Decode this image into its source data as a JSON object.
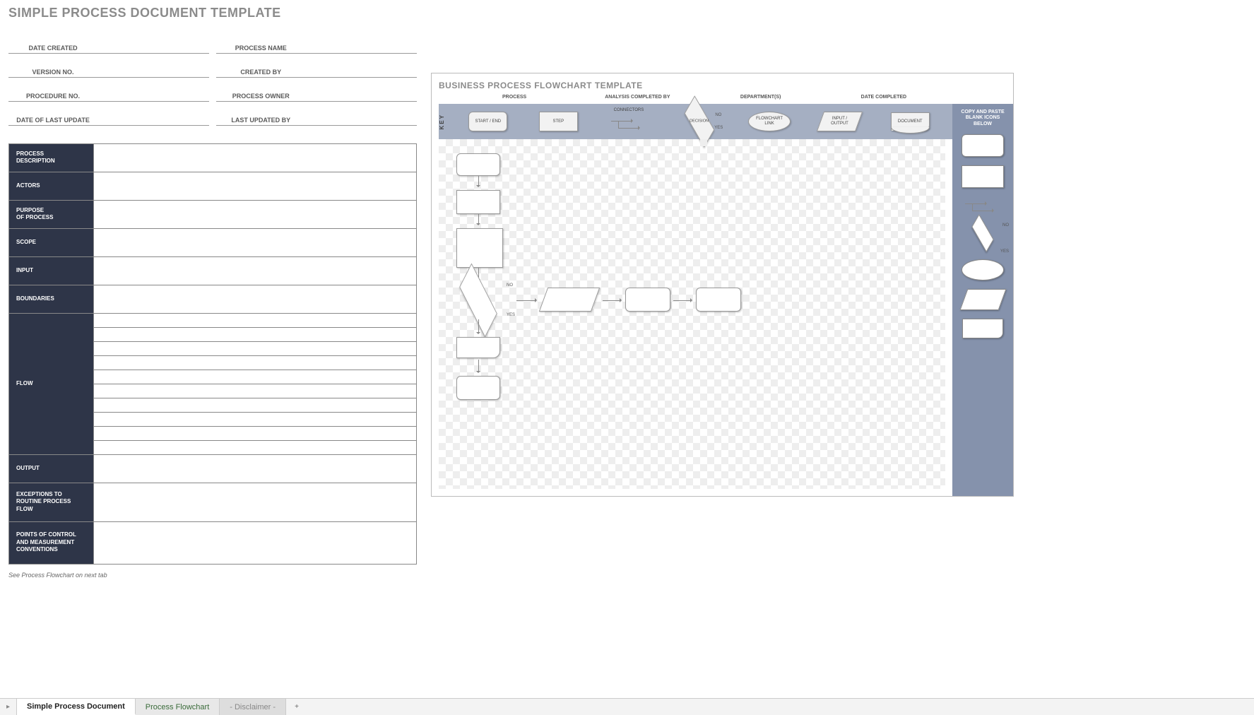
{
  "left": {
    "title": "SIMPLE PROCESS DOCUMENT TEMPLATE",
    "meta": {
      "r1a": "DATE CREATED",
      "r1b": "PROCESS NAME",
      "r2a": "VERSION NO.",
      "r2b": "CREATED BY",
      "r3a": "PROCEDURE NO.",
      "r3b": "PROCESS OWNER",
      "r4a": "DATE OF LAST UPDATE",
      "r4b": "LAST UPDATED BY"
    },
    "rows": {
      "process_description": "PROCESS\nDESCRIPTION",
      "actors": "ACTORS",
      "purpose": "PURPOSE\nOF PROCESS",
      "scope": "SCOPE",
      "input": "INPUT",
      "boundaries": "BOUNDARIES",
      "flow": "FLOW",
      "output": "OUTPUT",
      "exceptions": "EXCEPTIONS TO\nROUTINE PROCESS FLOW",
      "points": "POINTS OF CONTROL\nAND MEASUREMENT\nCONVENTIONS"
    },
    "footnote": "See Process Flowchart on next tab"
  },
  "right": {
    "title": "BUSINESS PROCESS FLOWCHART TEMPLATE",
    "headers": {
      "h1": "PROCESS",
      "h2": "ANALYSIS COMPLETED BY",
      "h3": "DEPARTMENT(S)",
      "h4": "DATE COMPLETED"
    },
    "key_label": "KEY",
    "shapes": {
      "startend": "START / END",
      "step": "STEP",
      "connectors": "CONNECTORS",
      "decision": "DECISION",
      "flowchart_link": "FLOWCHART\nLINK",
      "input_output": "INPUT /\nOUTPUT",
      "document": "DOCUMENT"
    },
    "sidebar_title": "COPY AND PASTE\nBLANK ICONS\nBELOW",
    "labels": {
      "no": "NO",
      "yes": "YES"
    }
  },
  "tabs": {
    "t1": "Simple Process Document",
    "t2": "Process Flowchart",
    "t3": "- Disclaimer -",
    "add": "+"
  }
}
